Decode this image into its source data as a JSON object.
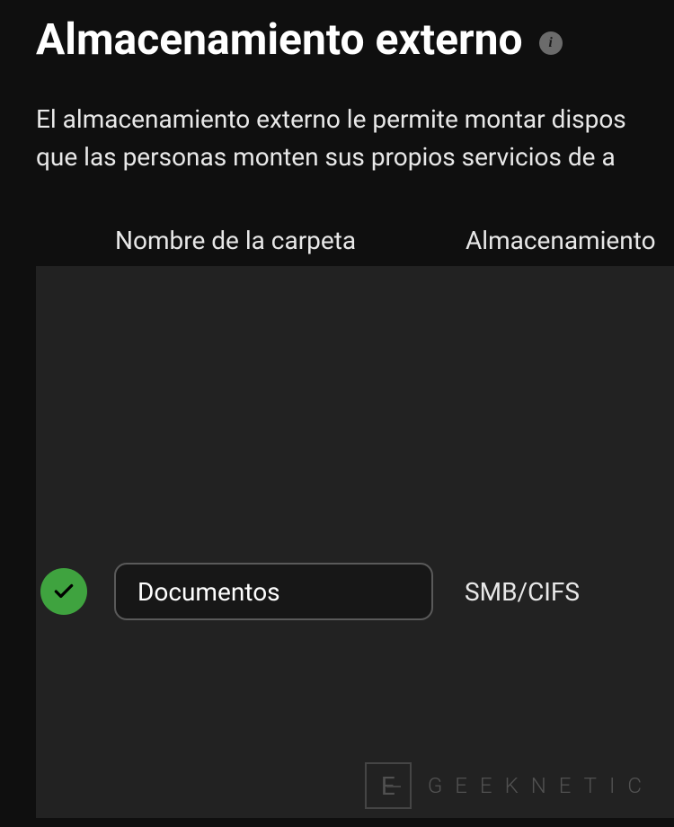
{
  "header": {
    "title": "Almacenamiento externo"
  },
  "description": {
    "line1": "El almacenamiento externo le permite montar dispos",
    "line2": "que las personas monten sus propios servicios de a"
  },
  "table": {
    "columns": {
      "folder_name": "Nombre de la carpeta",
      "storage": "Almacenamiento"
    },
    "rows": [
      {
        "folder_name": "Documentos",
        "storage_type": "SMB/CIFS",
        "status": "success"
      }
    ]
  },
  "watermark": {
    "logo_letter": "E",
    "text": "GEEKNETIC"
  }
}
